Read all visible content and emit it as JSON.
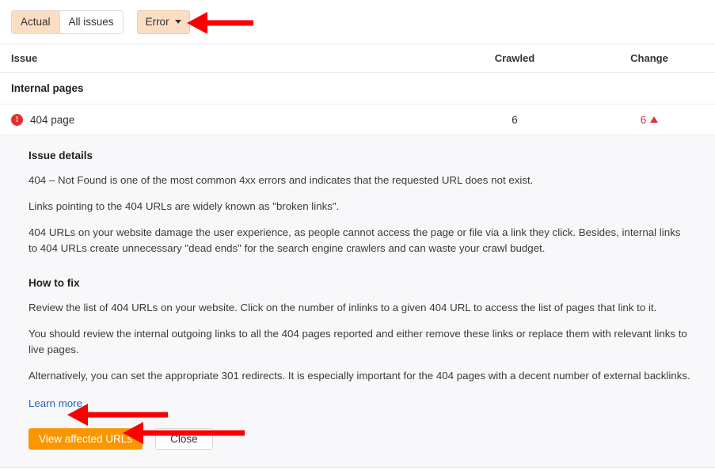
{
  "toolbar": {
    "segments": [
      {
        "label": "Actual",
        "active": true
      },
      {
        "label": "All issues",
        "active": false
      }
    ],
    "filter": {
      "label": "Error",
      "icon": "chevron-down-icon"
    },
    "accent_color": "#fbdec2"
  },
  "table": {
    "columns": [
      "Issue",
      "Crawled",
      "Change"
    ],
    "groups": [
      {
        "name": "Internal pages",
        "rows": [
          {
            "severity_icon": "error-icon",
            "issue": "404 page",
            "crawled": "6",
            "change": "6",
            "change_direction": "up",
            "change_color": "#d63636"
          }
        ]
      }
    ]
  },
  "detail": {
    "issue_details_heading": "Issue details",
    "issue_details_paragraphs": [
      "404 – Not Found is one of the most common 4xx errors and indicates that the requested URL does not exist.",
      "Links pointing to the 404 URLs are widely known as \"broken links\".",
      "404 URLs on your website damage the user experience, as people cannot access the page or file via a link they click. Besides, internal links to 404 URLs create unnecessary \"dead ends\" for the search engine crawlers and can waste your crawl budget."
    ],
    "how_to_fix_heading": "How to fix",
    "how_to_fix_paragraphs": [
      "Review the list of 404 URLs on your website. Click on the number of inlinks to a given 404 URL to access the list of pages that link to it.",
      "You should review the internal outgoing links to all the 404 pages reported and either remove these links or replace them with relevant links to live pages.",
      "Alternatively, you can set the appropriate 301 redirects. It is especially important for the 404 pages with a decent number of external backlinks."
    ],
    "learn_more_label": "Learn more",
    "primary_button": "View affected URLs",
    "secondary_button": "Close",
    "primary_button_color": "#fa9600",
    "link_color": "#2a62bc"
  },
  "annotations": {
    "arrow_color": "#fb0000",
    "arrows": [
      {
        "name": "arrow-to-error-filter",
        "points_to": "Error"
      },
      {
        "name": "arrow-to-how-to-fix",
        "points_to": "How to fix"
      },
      {
        "name": "arrow-to-close-button",
        "points_to": "Close"
      }
    ]
  }
}
